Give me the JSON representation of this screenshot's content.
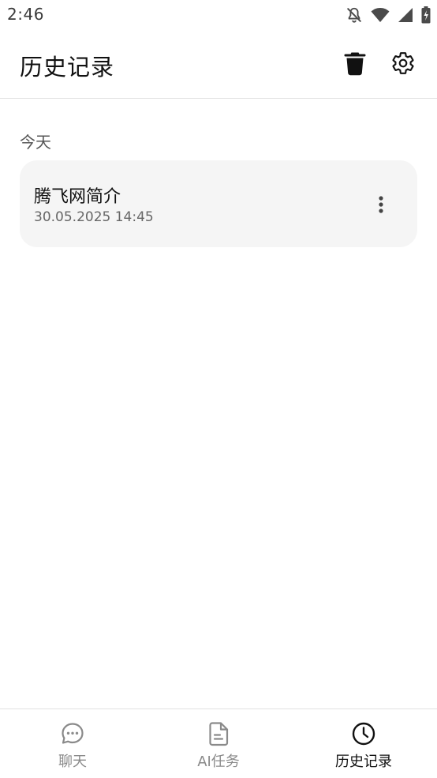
{
  "status_bar": {
    "time": "2:46"
  },
  "header": {
    "title": "历史记录"
  },
  "sections": [
    {
      "label": "今天",
      "items": [
        {
          "title": "腾飞网简介",
          "timestamp": "30.05.2025 14:45"
        }
      ]
    }
  ],
  "bottom_nav": {
    "items": [
      {
        "label": "聊天",
        "icon": "chat-bubble-icon",
        "active": false
      },
      {
        "label": "AI任务",
        "icon": "document-icon",
        "active": false
      },
      {
        "label": "历史记录",
        "icon": "clock-icon",
        "active": true
      }
    ]
  },
  "colors": {
    "active_nav": "#111111",
    "inactive_nav": "#8a8a8a",
    "card_background": "#f5f5f5",
    "divider": "#e2e2e2"
  }
}
